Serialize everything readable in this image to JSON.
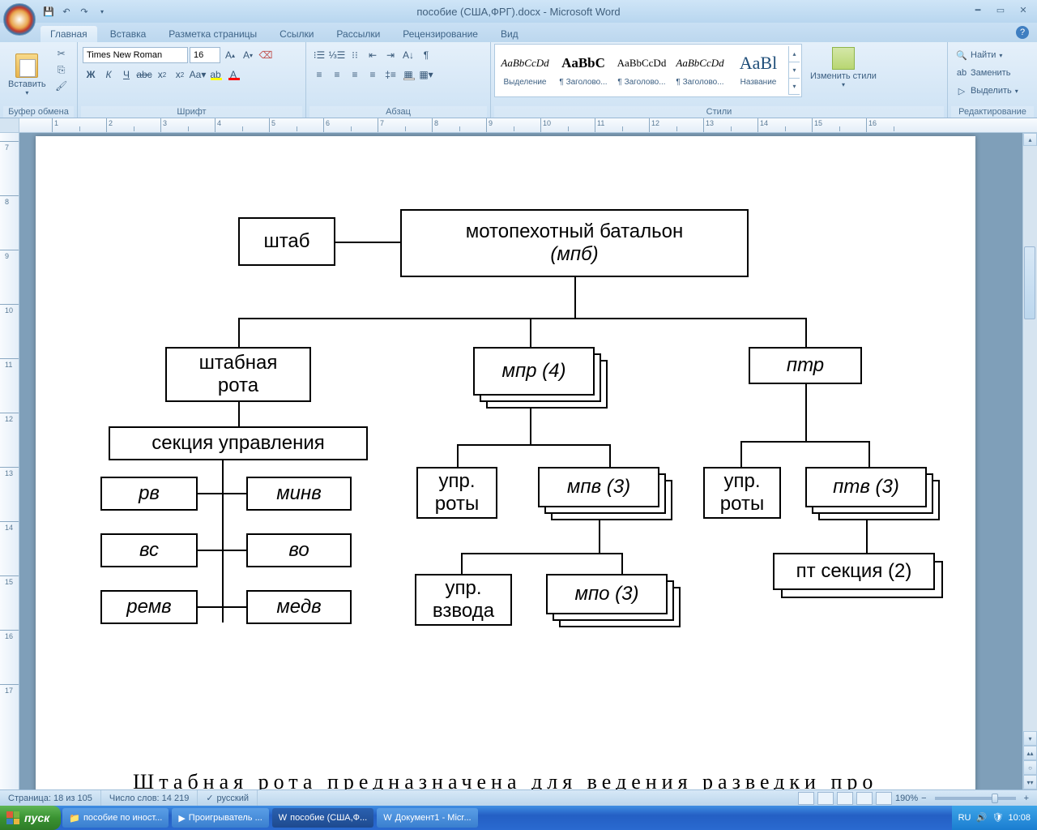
{
  "title": "пособие (США,ФРГ).docx - Microsoft Word",
  "tabs": [
    "Главная",
    "Вставка",
    "Разметка страницы",
    "Ссылки",
    "Рассылки",
    "Рецензирование",
    "Вид"
  ],
  "active_tab": 0,
  "groups": {
    "clipboard": {
      "title": "Буфер обмена",
      "paste": "Вставить"
    },
    "font": {
      "title": "Шрифт",
      "name": "Times New Roman",
      "size": "16"
    },
    "paragraph": {
      "title": "Абзац"
    },
    "styles": {
      "title": "Стили",
      "items": [
        {
          "preview": "AaBbCcDd",
          "name": "Выделение",
          "italic": true
        },
        {
          "preview": "AaBbC",
          "name": "¶ Заголово...",
          "bold": true
        },
        {
          "preview": "AaBbCcDd",
          "name": "¶ Заголово..."
        },
        {
          "preview": "AaBbCcDd",
          "name": "¶ Заголово...",
          "italic": true
        },
        {
          "preview": "AaBl",
          "name": "Название",
          "big": true
        }
      ],
      "change": "Изменить стили"
    },
    "editing": {
      "title": "Редактирование",
      "find": "Найти",
      "replace": "Заменить",
      "select": "Выделить"
    }
  },
  "ruler_h": [
    1,
    2,
    3,
    4,
    5,
    6,
    7,
    8,
    9,
    10,
    11,
    12,
    13,
    14,
    15,
    16
  ],
  "ruler_v": [
    7,
    8,
    9,
    10,
    11,
    12,
    13,
    14,
    15,
    16,
    17
  ],
  "diagram": {
    "shtab": "штаб",
    "root_l1": "мотопехотный батальон",
    "root_l2": "(мпб)",
    "shtabnaya_l1": "штабная",
    "shtabnaya_l2": "рота",
    "sekcia": "секция управления",
    "rv": "рв",
    "minv": "минв",
    "vs": "вс",
    "vo": "во",
    "remv": "ремв",
    "medv": "медв",
    "mpr": "мпр (4)",
    "upr_roty_l1": "упр.",
    "upr_roty_l2": "роты",
    "mpv": "мпв (3)",
    "upr_vzvoda_l1": "упр.",
    "upr_vzvoda_l2": "взвода",
    "mpo": "мпо (3)",
    "ptr": "птр",
    "ptv": "птв (3)",
    "pt_sekcia": "пт секция (2)",
    "bottom_text": "Штабная рота предназначена для ведения разведки про"
  },
  "status": {
    "page": "Страница: 18 из 105",
    "words": "Число слов: 14 219",
    "lang": "русский",
    "zoom": "190%"
  },
  "taskbar": {
    "start": "пуск",
    "items": [
      "пособие по иност...",
      "Проигрыватель ...",
      "пособие (США,Ф...",
      "Документ1 - Micr..."
    ],
    "active": 2,
    "lang": "RU",
    "time": "10:08"
  }
}
